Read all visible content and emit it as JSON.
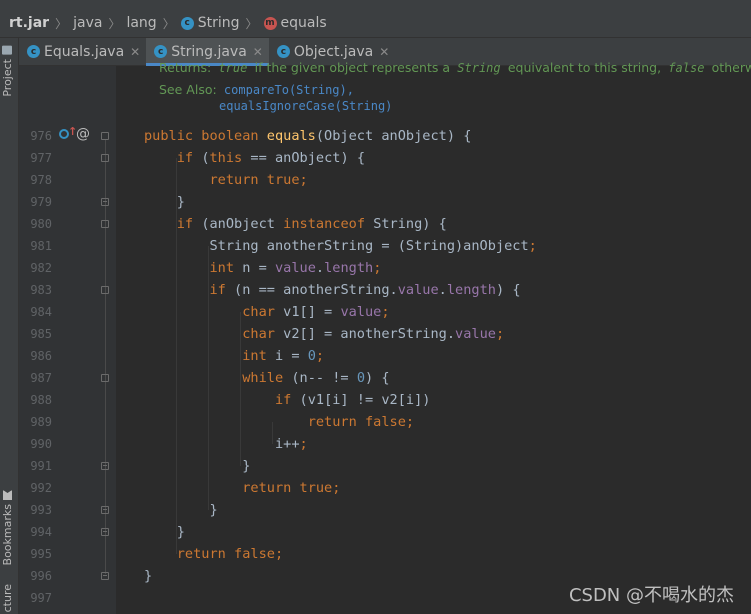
{
  "breadcrumbs": [
    {
      "label": "rt.jar"
    },
    {
      "label": "java"
    },
    {
      "label": "lang"
    },
    {
      "label": "String",
      "icon": "class-icon"
    },
    {
      "label": "equals",
      "icon": "method-icon"
    }
  ],
  "side_tabs": {
    "project": "Project",
    "bookmarks": "Bookmarks",
    "structure": "cture"
  },
  "tabs": [
    {
      "label": "Equals.java",
      "active": false
    },
    {
      "label": "String.java",
      "active": true
    },
    {
      "label": "Object.java",
      "active": false
    }
  ],
  "javadoc": {
    "returns_label": "Returns:",
    "returns_text_1": "true",
    "returns_text_2": "if the given object represents a",
    "returns_text_3": "String",
    "returns_text_4": "equivalent to this string,",
    "returns_text_5": "false",
    "returns_text_6": "otherwise",
    "see_also_label": "See Also:",
    "see_also_1": "compareTo(String),",
    "see_also_2": "equalsIgnoreCase(String)"
  },
  "line_numbers": [
    "976",
    "977",
    "978",
    "979",
    "980",
    "981",
    "982",
    "983",
    "984",
    "985",
    "986",
    "987",
    "988",
    "989",
    "990",
    "991",
    "992",
    "993",
    "994",
    "995",
    "996",
    "997"
  ],
  "watermark": "CSDN @不喝水的杰",
  "colors": {
    "background": "#2b2b2b",
    "keyword": "#cc7832",
    "function": "#ffc66d",
    "number": "#6897bb",
    "field": "#9876aa",
    "doc": "#629755",
    "accent": "#4a88c7"
  }
}
